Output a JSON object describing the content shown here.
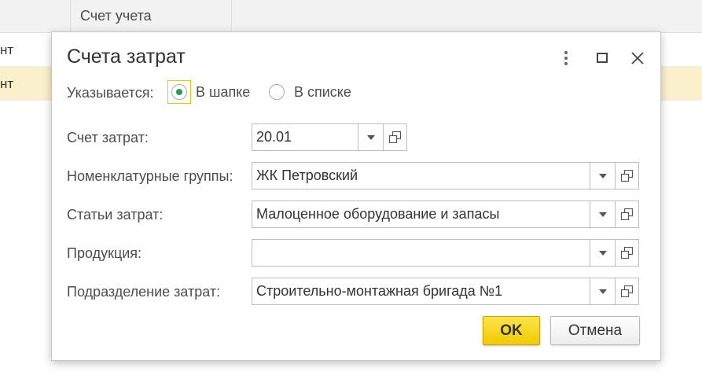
{
  "background_table": {
    "column_header": "Счет учета",
    "rows": [
      {
        "cell": "нт"
      },
      {
        "cell": "нт"
      }
    ]
  },
  "dialog": {
    "title": "Счета затрат",
    "mode_label": "Указывается:",
    "mode_options": [
      {
        "label": "В шапке",
        "selected": true
      },
      {
        "label": "В списке",
        "selected": false
      }
    ],
    "fields": [
      {
        "label": "Счет затрат:",
        "value": "20.01"
      },
      {
        "label": "Номенклатурные группы:",
        "value": "ЖК Петровский"
      },
      {
        "label": "Статьи затрат:",
        "value": "Малоценное оборудование и запасы"
      },
      {
        "label": "Продукция:",
        "value": ""
      },
      {
        "label": "Подразделение затрат:",
        "value": "Строительно-монтажная бригада №1"
      }
    ],
    "ok_label": "OK",
    "cancel_label": "Отмена"
  },
  "icons": {
    "more": "more-vertical-icon",
    "maximize": "maximize-icon",
    "close": "close-icon",
    "dropdown": "chevron-down-icon",
    "open": "open-form-icon"
  },
  "colors": {
    "accent_yellow": "#f5d40f",
    "radio_selected": "#2a9d4b",
    "selected_row": "#fbf0cc"
  }
}
